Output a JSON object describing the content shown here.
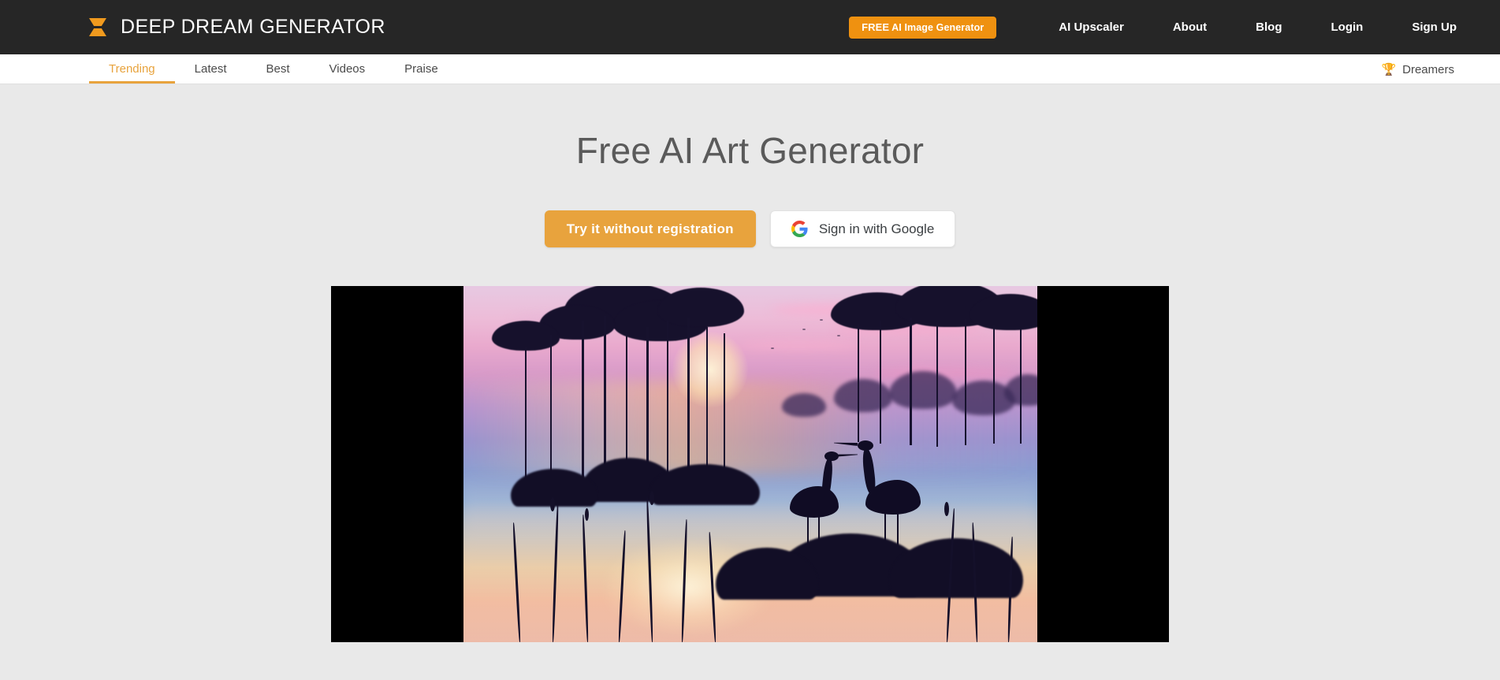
{
  "header": {
    "brand_title": "DEEP DREAM GENERATOR",
    "logo_icon": "hourglass-logo-icon",
    "cta_button": {
      "emphasis": "FREE",
      "label": "AI Image Generator",
      "color": "#ef9110"
    },
    "nav_links": [
      {
        "label": "AI Upscaler"
      },
      {
        "label": "About"
      },
      {
        "label": "Blog"
      },
      {
        "label": "Login"
      },
      {
        "label": "Sign Up"
      }
    ],
    "background_color": "#262626"
  },
  "sub_nav": {
    "tabs": [
      {
        "label": "Trending",
        "active": true
      },
      {
        "label": "Latest",
        "active": false
      },
      {
        "label": "Best",
        "active": false
      },
      {
        "label": "Videos",
        "active": false
      },
      {
        "label": "Praise",
        "active": false
      }
    ],
    "active_color": "#e8a33d",
    "dreamers": {
      "icon": "trophy-icon",
      "glyph": "🏆",
      "label": "Dreamers"
    }
  },
  "hero": {
    "title": "Free AI Art Generator",
    "primary_button": {
      "label": "Try it without registration",
      "color": "#e8a33d"
    },
    "google_button": {
      "label": "Sign in with Google",
      "icon": "google-g-icon"
    },
    "featured_artwork": {
      "alt": "Two heron silhouettes in misty sunset wetland with tall trees and reeds",
      "frame_color": "#000000",
      "palette": [
        "#edbcd8",
        "#b794cf",
        "#8c9ed2",
        "#93b0d4",
        "#eec08a",
        "#140f2a"
      ]
    }
  },
  "page": {
    "background_color": "#e9e9e9"
  }
}
